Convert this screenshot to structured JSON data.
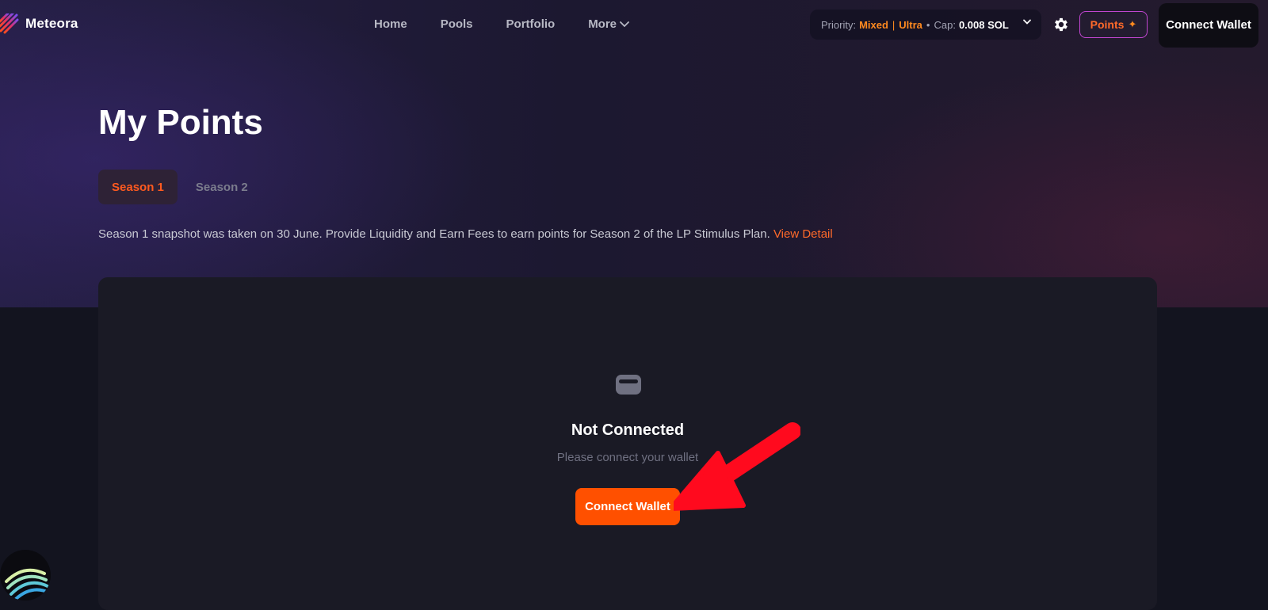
{
  "brand": {
    "name": "Meteora"
  },
  "nav": {
    "items": [
      {
        "label": "Home"
      },
      {
        "label": "Pools"
      },
      {
        "label": "Portfolio"
      }
    ],
    "more_label": "More"
  },
  "priority": {
    "label": "Priority:",
    "mode_a": "Mixed",
    "separator": "|",
    "mode_b": "Ultra",
    "dot": "•",
    "cap_label": "Cap:",
    "cap_value": "0.008 SOL"
  },
  "header": {
    "points_label": "Points",
    "connect_label": "Connect Wallet"
  },
  "page": {
    "title": "My Points",
    "tabs": [
      {
        "label": "Season 1",
        "active": true
      },
      {
        "label": "Season 2",
        "active": false
      }
    ],
    "notice_text": "Season 1 snapshot was taken on 30 June. Provide Liquidity and Earn Fees to earn points for Season 2 of the LP Stimulus Plan. ",
    "notice_link": "View Detail"
  },
  "empty_state": {
    "title": "Not Connected",
    "subtitle": "Please connect your wallet",
    "button_label": "Connect Wallet"
  },
  "colors": {
    "accent": "#ff5000",
    "highlight": "#ff8a1f",
    "annotation_arrow": "#ff0a1e"
  }
}
